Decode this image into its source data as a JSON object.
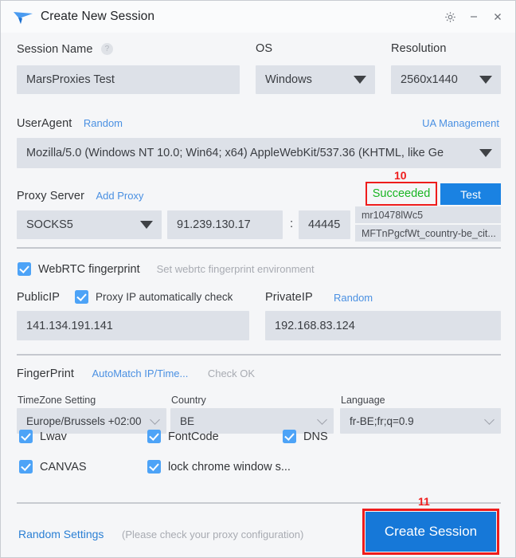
{
  "window": {
    "title": "Create New Session",
    "logo_icon": "blue-arrow-logo",
    "controls": {
      "settings": "gear-icon",
      "minimize": "minimize-icon",
      "close": "close-icon"
    }
  },
  "session": {
    "label": "Session Name",
    "help_icon": "?",
    "value": "MarsProxies Test"
  },
  "os": {
    "label": "OS",
    "value": "Windows"
  },
  "resolution": {
    "label": "Resolution",
    "value": "2560x1440"
  },
  "useragent": {
    "label": "UserAgent",
    "random_link": "Random",
    "management_link": "UA Management",
    "value": "Mozilla/5.0 (Windows NT 10.0; Win64; x64) AppleWebKit/537.36 (KHTML, like Ge"
  },
  "proxy": {
    "label": "Proxy Server",
    "add_link": "Add Proxy",
    "status": "Succeeded",
    "status_color": "#18b522",
    "test_button": "Test",
    "type": "SOCKS5",
    "host": "91.239.130.17",
    "separator": ":",
    "port": "44445",
    "username": "mr10478lWc5",
    "password": "MFTnPgcfWt_country-be_cit..."
  },
  "webrtc": {
    "label": "WebRTC fingerprint",
    "hint": "Set webrtc fingerprint environment",
    "checked": true,
    "public_ip_label": "PublicIP",
    "auto_check_label": "Proxy IP automatically check",
    "auto_check_checked": true,
    "public_ip_value": "141.134.191.141",
    "private_ip_label": "PrivateIP",
    "private_random_link": "Random",
    "private_ip_value": "192.168.83.124"
  },
  "fingerprint": {
    "label": "FingerPrint",
    "automatch_link": "AutoMatch IP/Time...",
    "check_status": "Check OK",
    "timezone_label": "TimeZone Setting",
    "timezone_value": "Europe/Brussels +02:00",
    "country_label": "Country",
    "country_value": "BE",
    "language_label": "Language",
    "language_value": "fr-BE;fr;q=0.9"
  },
  "options": [
    {
      "label": "Lwav",
      "checked": true
    },
    {
      "label": "FontCode",
      "checked": true
    },
    {
      "label": "DNS",
      "checked": true
    },
    {
      "label": "CANVAS",
      "checked": true
    },
    {
      "label": "lock chrome window s...",
      "checked": true
    }
  ],
  "footer": {
    "random_settings": "Random Settings",
    "note": "(Please check your proxy configuration)",
    "create_button": "Create Session"
  },
  "annotations": [
    {
      "number": "10",
      "target": "proxy-status-badge"
    },
    {
      "number": "11",
      "target": "create-session-button"
    }
  ],
  "colors": {
    "accent": "#1a82e2",
    "link": "#4a90e2",
    "success": "#18b522",
    "annotation": "#ee1c1c",
    "field_bg": "#dde1e8",
    "window_bg": "#f5f6f8"
  }
}
